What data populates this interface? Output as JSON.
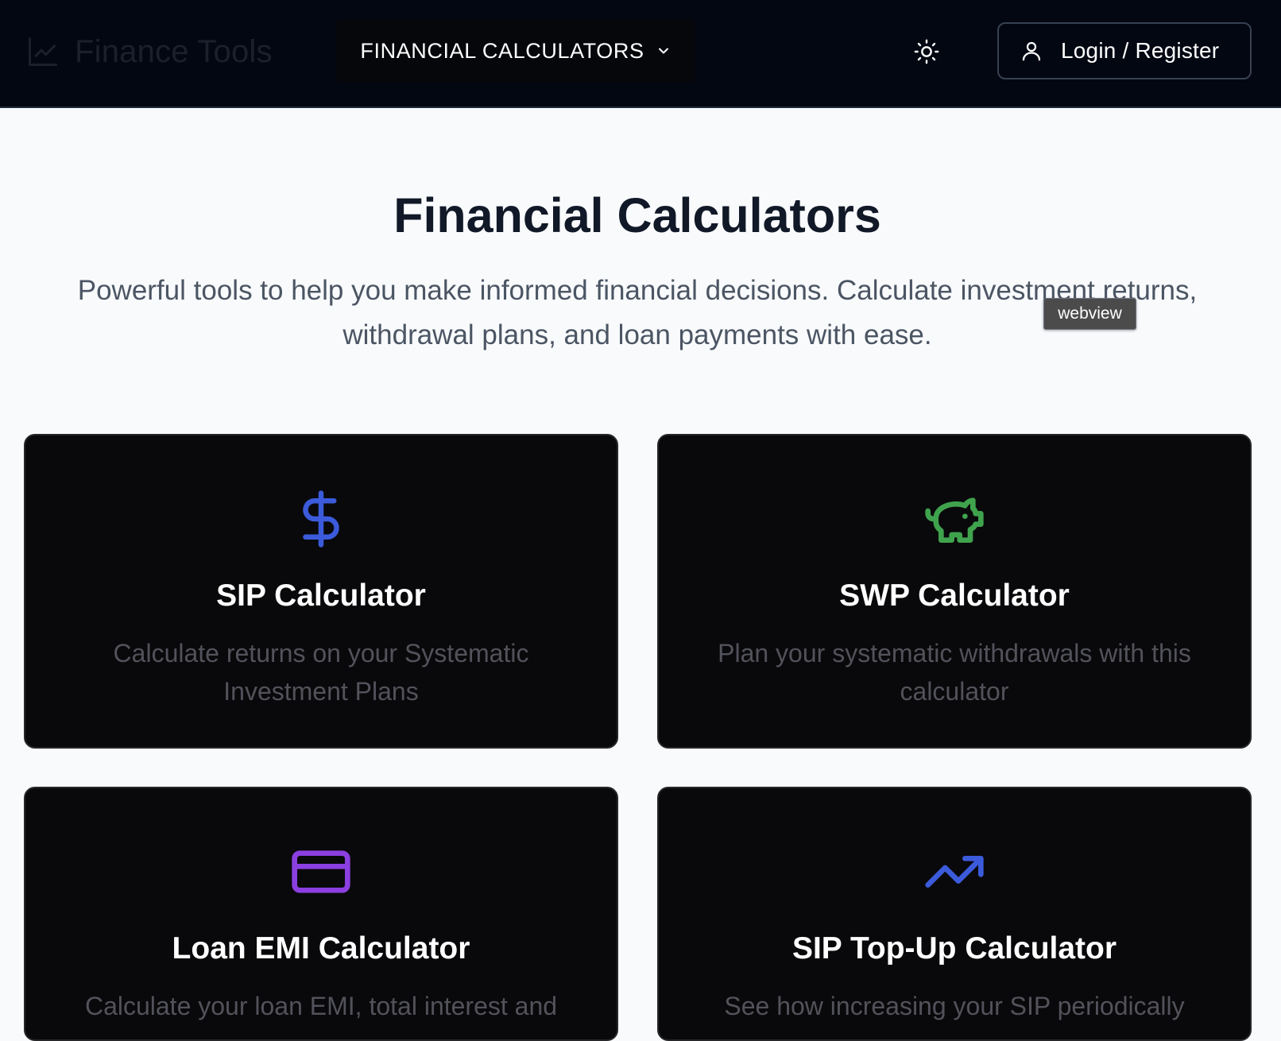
{
  "header": {
    "brand_name": "Finance Tools",
    "brand_icon": "chart-line-icon",
    "nav_dropdown_label": "FINANCIAL CALCULATORS",
    "theme_toggle_icon": "sun-icon",
    "login_label": "Login / Register",
    "login_icon": "user-icon"
  },
  "hero": {
    "title": "Financial Calculators",
    "subtitle": "Powerful tools to help you make informed financial decisions. Calculate investment returns, withdrawal plans, and loan payments with ease."
  },
  "tooltip": {
    "label": "webview"
  },
  "cards": [
    {
      "title": "SIP Calculator",
      "description": "Calculate returns on your Systematic Investment Plans",
      "icon": "dollar-sign-icon",
      "icon_color": "#3b5bdb"
    },
    {
      "title": "SWP Calculator",
      "description": "Plan your systematic withdrawals with this calculator",
      "icon": "piggy-bank-icon",
      "icon_color": "#3fa34d"
    },
    {
      "title": "Loan EMI Calculator",
      "description": "Calculate your loan EMI, total interest and",
      "icon": "credit-card-icon",
      "icon_color": "#8b3fe0"
    },
    {
      "title": "SIP Top-Up Calculator",
      "description": "See how increasing your SIP periodically",
      "icon": "trending-up-icon",
      "icon_color": "#3b5bdb"
    }
  ],
  "colors": {
    "header_bg": "#030712",
    "page_bg": "#f8fafc",
    "card_bg": "#09090b"
  }
}
